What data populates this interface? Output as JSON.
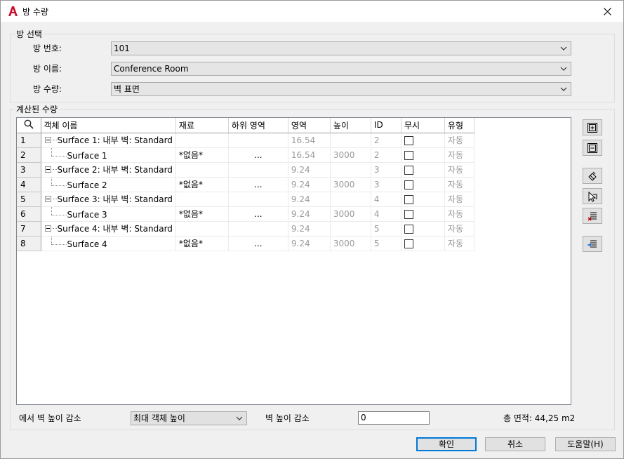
{
  "window": {
    "title": "방 수량"
  },
  "room_select": {
    "group_label": "방 선택",
    "room_number_label": "방 번호:",
    "room_number_value": "101",
    "room_name_label": "방 이름:",
    "room_name_value": "Conference Room",
    "room_quantity_label": "방 수량:",
    "room_quantity_value": "벽 표면"
  },
  "computed": {
    "group_label": "계산된 수량",
    "columns": [
      "객체 이름",
      "재료",
      "하위 영역",
      "영역",
      "높이",
      "ID",
      "무시",
      "유형"
    ],
    "rows": [
      {
        "num": "1",
        "name": "Surface 1: 내부 벽: Standard",
        "level": 0,
        "material": "",
        "sub": "",
        "area": "16.54",
        "height": "",
        "id": "2",
        "type": "자동"
      },
      {
        "num": "2",
        "name": "Surface 1",
        "level": 1,
        "material": "*없음*",
        "sub": "...",
        "area": "16.54",
        "height": "3000",
        "id": "2",
        "type": "자동"
      },
      {
        "num": "3",
        "name": "Surface 2: 내부 벽: Standard",
        "level": 0,
        "material": "",
        "sub": "",
        "area": "9.24",
        "height": "",
        "id": "3",
        "type": "자동"
      },
      {
        "num": "4",
        "name": "Surface 2",
        "level": 1,
        "material": "*없음*",
        "sub": "...",
        "area": "9.24",
        "height": "3000",
        "id": "3",
        "type": "자동"
      },
      {
        "num": "5",
        "name": "Surface 3: 내부 벽: Standard",
        "level": 0,
        "material": "",
        "sub": "",
        "area": "9.24",
        "height": "",
        "id": "4",
        "type": "자동"
      },
      {
        "num": "6",
        "name": "Surface 3",
        "level": 1,
        "material": "*없음*",
        "sub": "...",
        "area": "9.24",
        "height": "3000",
        "id": "4",
        "type": "자동"
      },
      {
        "num": "7",
        "name": "Surface 4: 내부 벽: Standard",
        "level": 0,
        "material": "",
        "sub": "",
        "area": "9.24",
        "height": "",
        "id": "5",
        "type": "자동"
      },
      {
        "num": "8",
        "name": "Surface 4",
        "level": 1,
        "material": "*없음*",
        "sub": "...",
        "area": "9.24",
        "height": "3000",
        "id": "5",
        "type": "자동"
      }
    ]
  },
  "bottom": {
    "reduce_from_label": "에서 벽 높이 감소",
    "reduce_from_value": "최대 객체 높이",
    "reduce_label": "벽 높이 감소",
    "reduce_value": "0",
    "total_area": "총 면적: 44,25 m2"
  },
  "buttons": {
    "ok": "확인",
    "cancel": "취소",
    "help": "도움말(H)"
  },
  "icons": [
    "autocad-logo-icon",
    "close-icon",
    "search-icon",
    "chevron-down-icon",
    "expand-all-icon",
    "collapse-all-icon",
    "select-objects-icon",
    "pick-surface-icon",
    "remove-surface-icon",
    "import-icon"
  ],
  "colors": {
    "accent": "#0078d7",
    "logo": "#c8102e"
  }
}
